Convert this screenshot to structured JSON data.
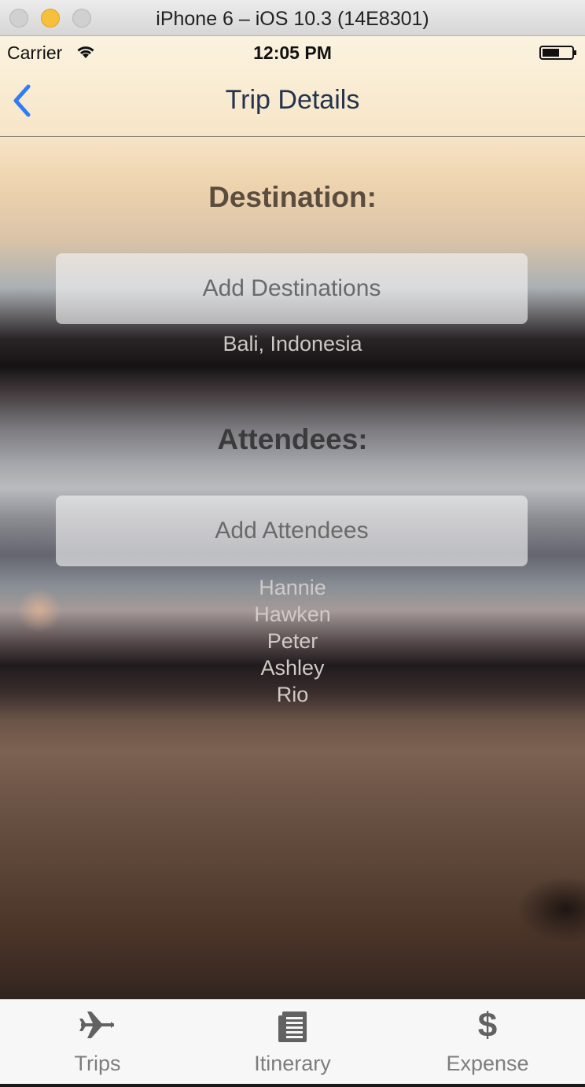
{
  "window": {
    "title": "iPhone 6 – iOS 10.3 (14E8301)"
  },
  "status_bar": {
    "carrier": "Carrier",
    "time": "12:05 PM"
  },
  "nav": {
    "title": "Trip Details",
    "back_icon": "chevron-left-icon"
  },
  "destination": {
    "heading": "Destination:",
    "add_button_label": "Add Destinations",
    "value": "Bali, Indonesia"
  },
  "attendees": {
    "heading": "Attendees:",
    "add_button_label": "Add Attendees",
    "names": [
      "Hannie",
      "Hawken",
      "Peter",
      "Ashley",
      "Rio"
    ]
  },
  "tabs": [
    {
      "label": "Trips",
      "icon": "airplane-icon"
    },
    {
      "label": "Itinerary",
      "icon": "document-icon"
    },
    {
      "label": "Expense",
      "icon": "dollar-icon",
      "glyph": "$"
    }
  ],
  "colors": {
    "nav_title": "#23344e",
    "back_accent": "#2f7cf6",
    "tab_icon": "#626262",
    "tab_label": "#7d7d7d"
  }
}
